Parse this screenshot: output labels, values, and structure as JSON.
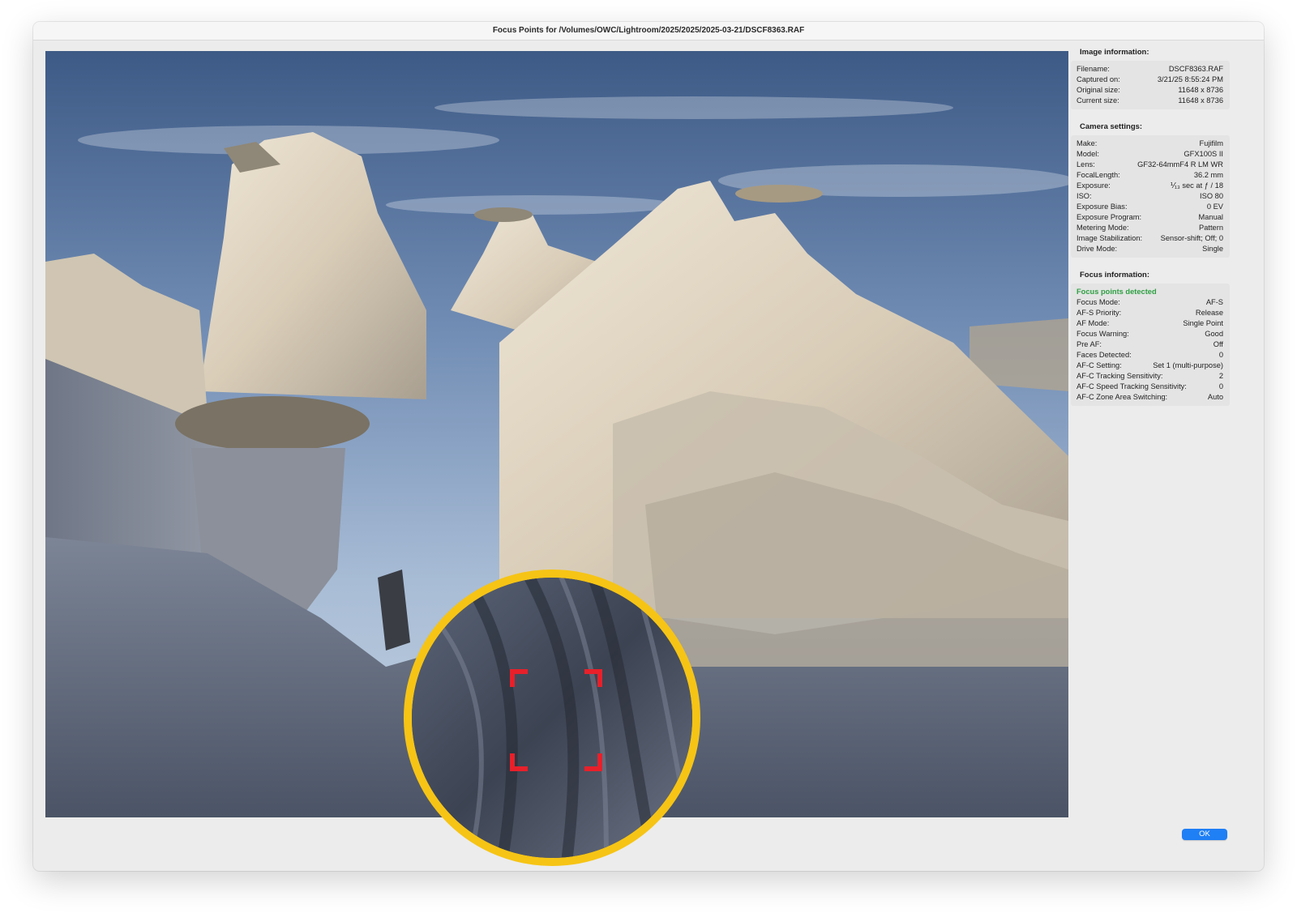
{
  "window": {
    "title": "Focus Points for /Volumes/OWC/Lightroom/2025/2025/2025-03-21/DSCF8363.RAF"
  },
  "image_info": {
    "heading": "Image information:",
    "rows": [
      {
        "label": "Filename:",
        "value": "DSCF8363.RAF"
      },
      {
        "label": "Captured on:",
        "value": "3/21/25 8:55:24 PM"
      },
      {
        "label": "Original size:",
        "value": "11648 x 8736"
      },
      {
        "label": "Current size:",
        "value": "11648 x 8736"
      }
    ]
  },
  "camera_settings": {
    "heading": "Camera settings:",
    "rows": [
      {
        "label": "Make:",
        "value": "Fujifilm"
      },
      {
        "label": "Model:",
        "value": "GFX100S II"
      },
      {
        "label": "Lens:",
        "value": "GF32-64mmF4 R LM WR"
      },
      {
        "label": "FocalLength:",
        "value": "36.2 mm"
      },
      {
        "label": "Exposure:",
        "value": "⅟₁₃ sec at ƒ / 18"
      },
      {
        "label": "ISO:",
        "value": "ISO 80"
      },
      {
        "label": "Exposure Bias:",
        "value": "0 EV"
      },
      {
        "label": "Exposure Program:",
        "value": "Manual"
      },
      {
        "label": "Metering Mode:",
        "value": "Pattern"
      },
      {
        "label": "Image Stabilization:",
        "value": "Sensor-shift; Off; 0"
      },
      {
        "label": "Drive Mode:",
        "value": "Single"
      }
    ]
  },
  "focus_info": {
    "heading": "Focus information:",
    "status": "Focus points detected",
    "status_color": "#2ea043",
    "rows": [
      {
        "label": "Focus Mode:",
        "value": "AF-S"
      },
      {
        "label": "AF-S Priority:",
        "value": "Release"
      },
      {
        "label": "AF Mode:",
        "value": "Single Point"
      },
      {
        "label": "Focus Warning:",
        "value": "Good"
      },
      {
        "label": "Pre AF:",
        "value": "Off"
      },
      {
        "label": "Faces Detected:",
        "value": "0"
      },
      {
        "label": "AF-C Setting:",
        "value": "Set 1 (multi-purpose)"
      },
      {
        "label": "AF-C Tracking Sensitivity:",
        "value": "2"
      },
      {
        "label": "AF-C Speed Tracking Sensitivity:",
        "value": "0"
      },
      {
        "label": "AF-C Zone Area Switching:",
        "value": "Auto"
      }
    ]
  },
  "buttons": {
    "ok_label": "OK",
    "ok_color": "#1f7ff5"
  },
  "colors": {
    "magnifier_ring": "#f6c415",
    "focus_point": "#e8202a"
  },
  "icons": {
    "focus_point": "focus-point-brackets-icon"
  }
}
